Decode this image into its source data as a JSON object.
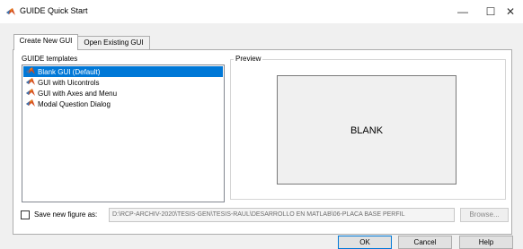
{
  "window": {
    "title": "GUIDE Quick Start",
    "minimize_glyph": "—",
    "maximize_glyph": "☐",
    "close_glyph": "✕"
  },
  "tabs": [
    {
      "label": "Create New GUI",
      "selected": true
    },
    {
      "label": "Open Existing GUI",
      "selected": false
    }
  ],
  "templates": {
    "label": "GUIDE templates",
    "items": [
      {
        "label": "Blank GUI (Default)",
        "selected": true
      },
      {
        "label": "GUI with Uicontrols",
        "selected": false
      },
      {
        "label": "GUI with Axes and Menu",
        "selected": false
      },
      {
        "label": "Modal Question Dialog",
        "selected": false
      }
    ]
  },
  "preview": {
    "label": "Preview",
    "text": "BLANK"
  },
  "save": {
    "checkbox_label": "Save new figure as:",
    "checked": false,
    "path": "D:\\RCP-ARCHIV-2020\\TESIS-GEN\\TESIS-RAUL\\DESARROLLO EN MATLAB\\06-PLACA BASE PERFIL",
    "browse_label": "Browse..."
  },
  "buttons": {
    "ok": "OK",
    "cancel": "Cancel",
    "help": "Help"
  },
  "colors": {
    "selection": "#0078d7",
    "matlab_icon_red": "#d44a1c",
    "matlab_icon_orange": "#e8851f"
  },
  "icons": {
    "app": "matlab-logo-icon",
    "template": "matlab-logo-icon"
  }
}
